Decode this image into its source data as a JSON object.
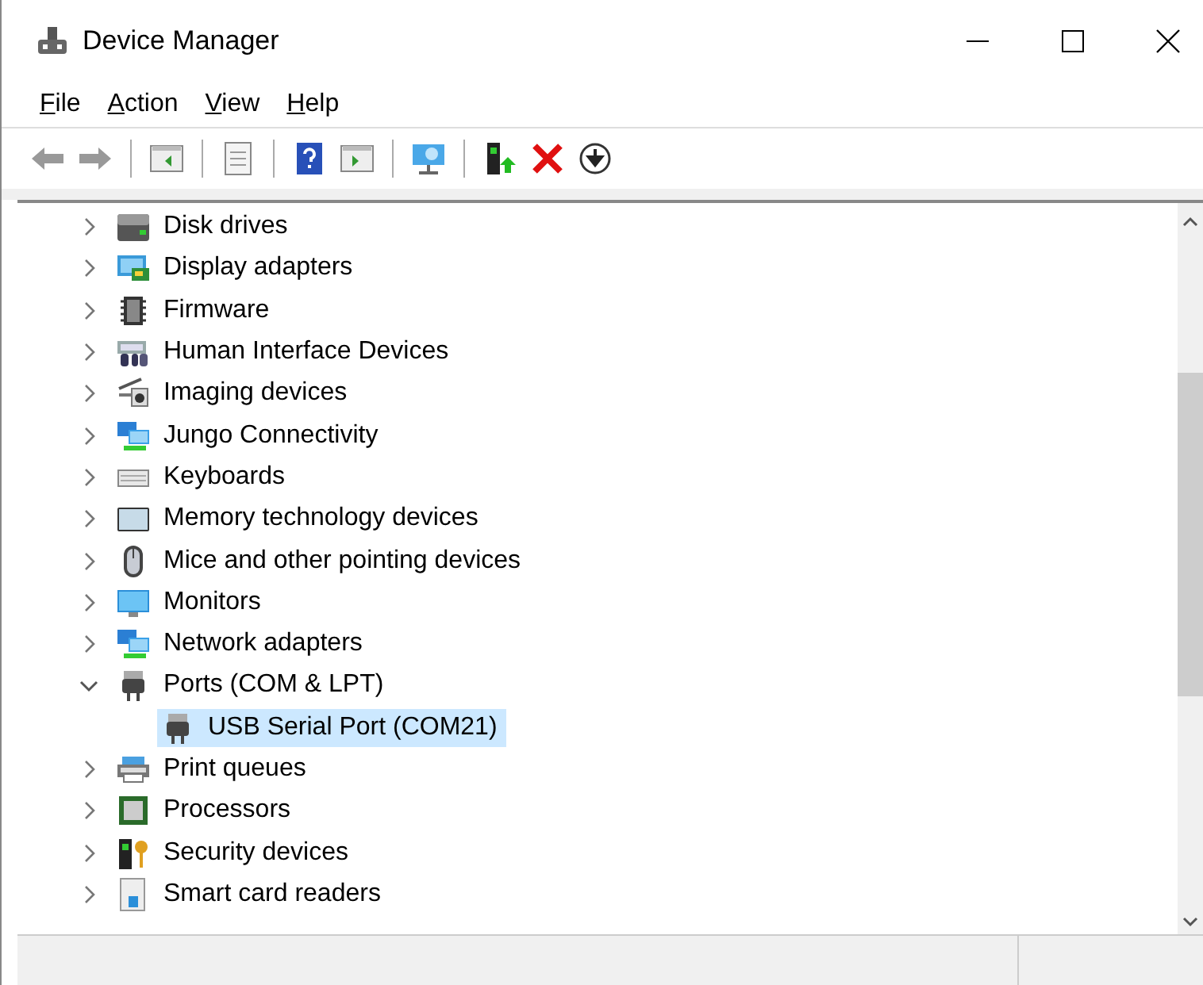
{
  "window": {
    "title": "Device Manager"
  },
  "menu": [
    {
      "label": "File"
    },
    {
      "label": "Action"
    },
    {
      "label": "View"
    },
    {
      "label": "Help"
    }
  ],
  "tree": [
    {
      "label": "Disk drives",
      "expanded": false
    },
    {
      "label": "Display adapters",
      "expanded": false
    },
    {
      "label": "Firmware",
      "expanded": false
    },
    {
      "label": "Human Interface Devices",
      "expanded": false
    },
    {
      "label": "Imaging devices",
      "expanded": false
    },
    {
      "label": "Jungo Connectivity",
      "expanded": false
    },
    {
      "label": "Keyboards",
      "expanded": false
    },
    {
      "label": "Memory technology devices",
      "expanded": false
    },
    {
      "label": "Mice and other pointing devices",
      "expanded": false
    },
    {
      "label": "Monitors",
      "expanded": false
    },
    {
      "label": "Network adapters",
      "expanded": false
    },
    {
      "label": "Ports (COM & LPT)",
      "expanded": true,
      "children": [
        {
          "label": "USB Serial Port (COM21)",
          "selected": true
        }
      ]
    },
    {
      "label": "Print queues",
      "expanded": false
    },
    {
      "label": "Processors",
      "expanded": false
    },
    {
      "label": "Security devices",
      "expanded": false
    },
    {
      "label": "Smart card readers",
      "expanded": false
    }
  ]
}
